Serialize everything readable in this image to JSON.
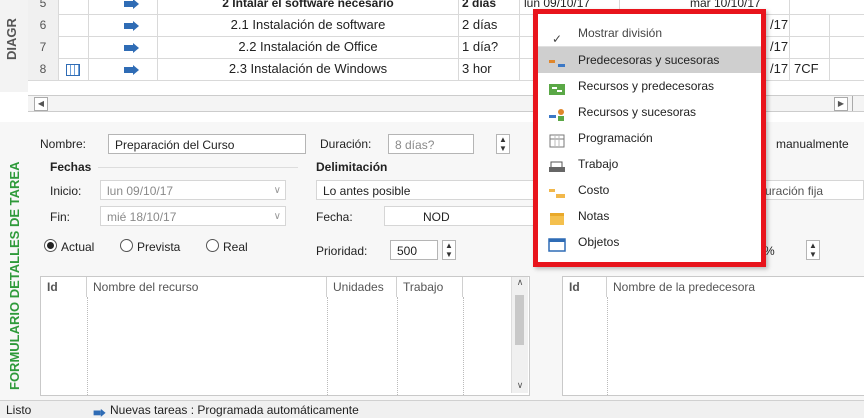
{
  "gantt": {
    "side_label": "DIAGR",
    "rows": [
      {
        "num": "5",
        "name": "2 Intalar el software necesario",
        "dur": "2 días",
        "start": "lun 09/10/17",
        "finish": "mar 10/10/17",
        "pred": ""
      },
      {
        "num": "6",
        "name": "2.1 Instalación de software",
        "dur": "2 días",
        "start": "",
        "finish": "/17",
        "pred": ""
      },
      {
        "num": "7",
        "name": "2.2 Instalación de Office",
        "dur": "1 día?",
        "start": "",
        "finish": "/17",
        "pred": ""
      },
      {
        "num": "8",
        "name": "2.3 Instalación de Windows",
        "dur": "3 hor",
        "start": "",
        "finish": "/17",
        "pred": "7CF"
      }
    ]
  },
  "form": {
    "side_label": "FORMULARIO DETALLES DE TAREA",
    "name_label": "Nombre:",
    "name_value": "Preparación del Curso",
    "duration_label": "Duración:",
    "duration_value": "8 días?",
    "manual_label": "manualmente",
    "dates_label": "Fechas",
    "start_label": "Inicio:",
    "start_value": "lun 09/10/17",
    "finish_label": "Fin:",
    "finish_value": "mié 18/10/17",
    "constraint_label": "Delimitación",
    "constraint_type": "Lo antes posible",
    "date_label": "Fecha:",
    "date_value": "NOD",
    "task_type_value": "uración fija",
    "radio_actual": "Actual",
    "radio_prevista": "Prevista",
    "radio_real": "Real",
    "priority_label": "Prioridad:",
    "priority_value": "500",
    "percent_suffix": "%",
    "resources_table": {
      "col_id": "Id",
      "col_name": "Nombre del recurso",
      "col_units": "Unidades",
      "col_work": "Trabajo"
    },
    "pred_table": {
      "col_id": "Id",
      "col_name": "Nombre de la predecesora"
    }
  },
  "menu": {
    "items": [
      {
        "label": "Mostrar división",
        "icon": "check-icon",
        "selected": false
      },
      {
        "label": "Predecesoras y sucesoras",
        "icon": "predecessor-successor-icon",
        "selected": true
      },
      {
        "label": "Recursos y predecesoras",
        "icon": "resources-predecessors-icon",
        "selected": false
      },
      {
        "label": "Recursos y sucesoras",
        "icon": "resources-successors-icon",
        "selected": false
      },
      {
        "label": "Programación",
        "icon": "schedule-icon",
        "selected": false
      },
      {
        "label": "Trabajo",
        "icon": "work-icon",
        "selected": false
      },
      {
        "label": "Costo",
        "icon": "cost-icon",
        "selected": false
      },
      {
        "label": "Notas",
        "icon": "notes-icon",
        "selected": false
      },
      {
        "label": "Objetos",
        "icon": "objects-icon",
        "selected": false
      }
    ],
    "highlight_color": "#e8141c"
  },
  "status": {
    "ready": "Listo",
    "new_tasks": "Nuevas tareas : Programada automáticamente"
  }
}
